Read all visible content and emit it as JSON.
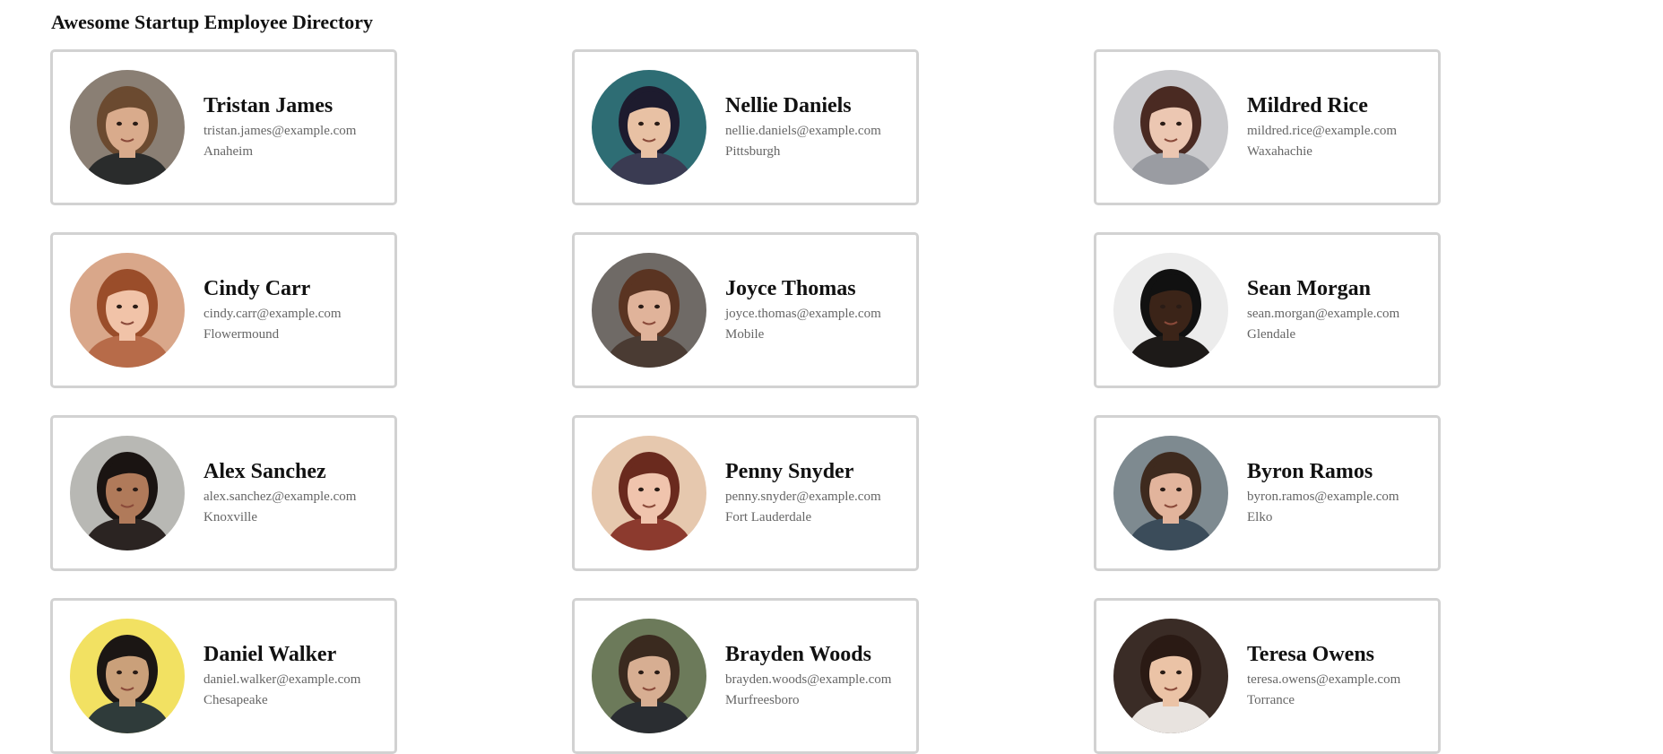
{
  "page": {
    "title": "Awesome Startup Employee Directory"
  },
  "employees": [
    {
      "name": "Tristan James",
      "email": "tristan.james@example.com",
      "city": "Anaheim",
      "bg": "#8a7f74",
      "skin": "#d9ab8c",
      "hair": "#6b4a30",
      "shirt": "#2a2c2c"
    },
    {
      "name": "Nellie Daniels",
      "email": "nellie.daniels@example.com",
      "city": "Pittsburgh",
      "bg": "#2e6d74",
      "skin": "#e8c1a4",
      "hair": "#1d1b2e",
      "shirt": "#3a3b52"
    },
    {
      "name": "Mildred Rice",
      "email": "mildred.rice@example.com",
      "city": "Waxahachie",
      "bg": "#c9c9cc",
      "skin": "#ecc7b2",
      "hair": "#4a2a22",
      "shirt": "#9a9ca2"
    },
    {
      "name": "Cindy Carr",
      "email": "cindy.carr@example.com",
      "city": "Flowermound",
      "bg": "#d9a78a",
      "skin": "#f1c3a8",
      "hair": "#9a4d2a",
      "shirt": "#b76b49"
    },
    {
      "name": "Joyce Thomas",
      "email": "joyce.thomas@example.com",
      "city": "Mobile",
      "bg": "#6f6a66",
      "skin": "#e0b39a",
      "hair": "#5a3422",
      "shirt": "#4a3b33"
    },
    {
      "name": "Sean Morgan",
      "email": "sean.morgan@example.com",
      "city": "Glendale",
      "bg": "#ececec",
      "skin": "#3b2418",
      "hair": "#111111",
      "shirt": "#1d1a18"
    },
    {
      "name": "Alex Sanchez",
      "email": "alex.sanchez@example.com",
      "city": "Knoxville",
      "bg": "#b8b8b4",
      "skin": "#b07a5a",
      "hair": "#1a1412",
      "shirt": "#2b2422"
    },
    {
      "name": "Penny Snyder",
      "email": "penny.snyder@example.com",
      "city": "Fort Lauderdale",
      "bg": "#e6c8ae",
      "skin": "#f0c4ad",
      "hair": "#6a2a1e",
      "shirt": "#8c3a2e"
    },
    {
      "name": "Byron Ramos",
      "email": "byron.ramos@example.com",
      "city": "Elko",
      "bg": "#7e8a90",
      "skin": "#e2b49c",
      "hair": "#3e2a1e",
      "shirt": "#3b4c5a"
    },
    {
      "name": "Daniel Walker",
      "email": "daniel.walker@example.com",
      "city": "Chesapeake",
      "bg": "#f2e162",
      "skin": "#caa07a",
      "hair": "#1b1614",
      "shirt": "#2f3b3a"
    },
    {
      "name": "Brayden Woods",
      "email": "brayden.woods@example.com",
      "city": "Murfreesboro",
      "bg": "#6c7a5a",
      "skin": "#d7ae92",
      "hair": "#3a2a1f",
      "shirt": "#2a2d31"
    },
    {
      "name": "Teresa Owens",
      "email": "teresa.owens@example.com",
      "city": "Torrance",
      "bg": "#3a2c26",
      "skin": "#ebc3a6",
      "hair": "#2a1a14",
      "shirt": "#e8e3df"
    }
  ]
}
